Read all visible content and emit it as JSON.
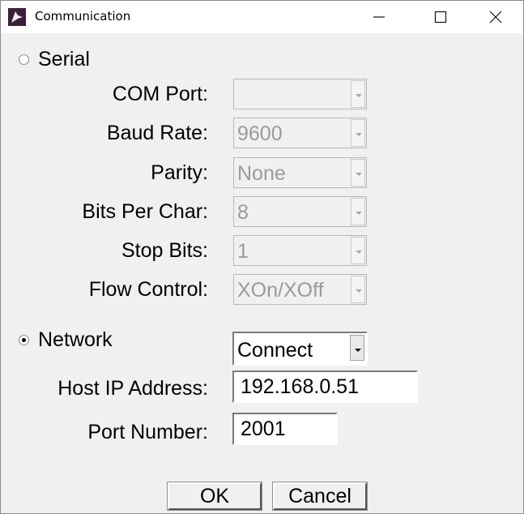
{
  "window": {
    "title": "Communication",
    "icon": "app-logo-icon",
    "controls": {
      "minimize": "minimize-icon",
      "maximize": "maximize-icon",
      "close": "close-icon"
    }
  },
  "serial": {
    "radio_label": "Serial",
    "selected": false,
    "fields": [
      {
        "label": "COM Port:",
        "value": ""
      },
      {
        "label": "Baud Rate:",
        "value": "9600"
      },
      {
        "label": "Parity:",
        "value": "None"
      },
      {
        "label": "Bits Per Char:",
        "value": "8"
      },
      {
        "label": "Stop Bits:",
        "value": "1"
      },
      {
        "label": "Flow Control:",
        "value": "XOn/XOff"
      }
    ]
  },
  "network": {
    "radio_label": "Network",
    "selected": true,
    "mode": "Connect",
    "host_label": "Host IP Address:",
    "host_value": "192.168.0.51",
    "port_label": "Port Number:",
    "port_value": "2001"
  },
  "buttons": {
    "ok": "OK",
    "cancel": "Cancel"
  }
}
